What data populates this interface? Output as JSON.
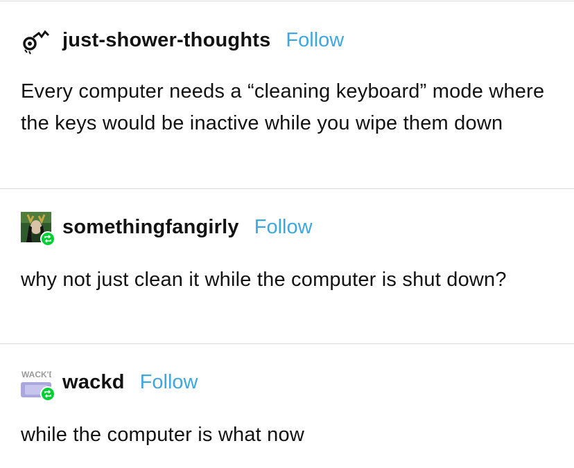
{
  "posts": [
    {
      "username": "just-shower-thoughts",
      "follow_label": "Follow",
      "avatar_icon": "showerhead-icon",
      "reblogged": false,
      "text": "Every computer needs a “cleaning keyboard” mode where the keys would be inactive while you wipe them down"
    },
    {
      "username": "somethingfangirly",
      "follow_label": "Follow",
      "avatar_icon": "loki-avatar",
      "reblogged": true,
      "text": "why not just clean it while the computer is shut down?"
    },
    {
      "username": "wackd",
      "follow_label": "Follow",
      "avatar_icon": "wackd-logo-avatar",
      "avatar_text": "WACK'D",
      "reblogged": true,
      "text": "while the computer is what now"
    }
  ],
  "colors": {
    "follow": "#3ea7e0",
    "reblog_badge": "#00cf35",
    "divider": "#d9d9d9",
    "text": "#121212"
  }
}
